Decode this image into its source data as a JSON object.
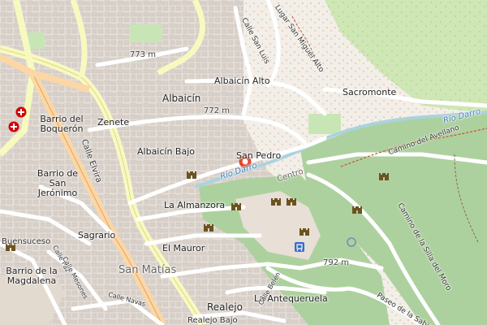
{
  "map": {
    "places": {
      "albaicin_alto": "Albaicín Alto",
      "albaicin": "Albaicín",
      "albaicin_bajo": "Albaicín Bajo",
      "sacromonte": "Sacromonte",
      "san_pedro": "San Pedro",
      "zenete": "Zenete",
      "barrio_boqueron": "Barrio del Boquerón",
      "barrio_san_jeronimo": "Barrio de San Jerónimo",
      "la_almanzora": "La Almanzora",
      "sagrario": "Sagrario",
      "el_mauror": "El Mauror",
      "san_matias": "San Matías",
      "barrio_magdalena": "Barrio de la Magdalena",
      "buensuceso": "Buensuceso",
      "la_antequeruela": "La Antequeruela",
      "realejo": "Realejo",
      "realejo_bajo": "Realejo Bajo"
    },
    "elevations": {
      "e773": "773 m",
      "e772": "772 m",
      "e792": "792 m"
    },
    "streets": {
      "calle_elvira": "Calle Elvira",
      "calle_san_luis": "Calle San Luis",
      "lugar_san_miguel_alto": "Lugar San Miguel Alto",
      "camino_avellano": "Camino del Avellano",
      "camino_silla_moro": "Camino de la Silla del Moro",
      "paseo_sabica": "Paseo de la Sabica",
      "centro": "Centro",
      "calle_paz": "Calle Paz",
      "calle_mesones": "Calle Mesones",
      "calle_navas": "Calle Navas",
      "calle_belen": "Calle Belén"
    },
    "rivers": {
      "rio_darro_1": "Río Darro",
      "rio_darro_2": "Río Darro"
    },
    "colors": {
      "background": "#eae6e1",
      "park": "#c8e6b5",
      "forest": "#add19e",
      "water": "#aad3df",
      "major_road": "#f7fabf",
      "primary_road": "#fcd6a4",
      "castle": "#6b5220",
      "marker": "#e2472a",
      "hospital": "#d40000"
    },
    "icons": [
      "castle-icon",
      "hospital-icon",
      "location-marker-icon",
      "metro-icon",
      "viewpoint-icon"
    ]
  }
}
